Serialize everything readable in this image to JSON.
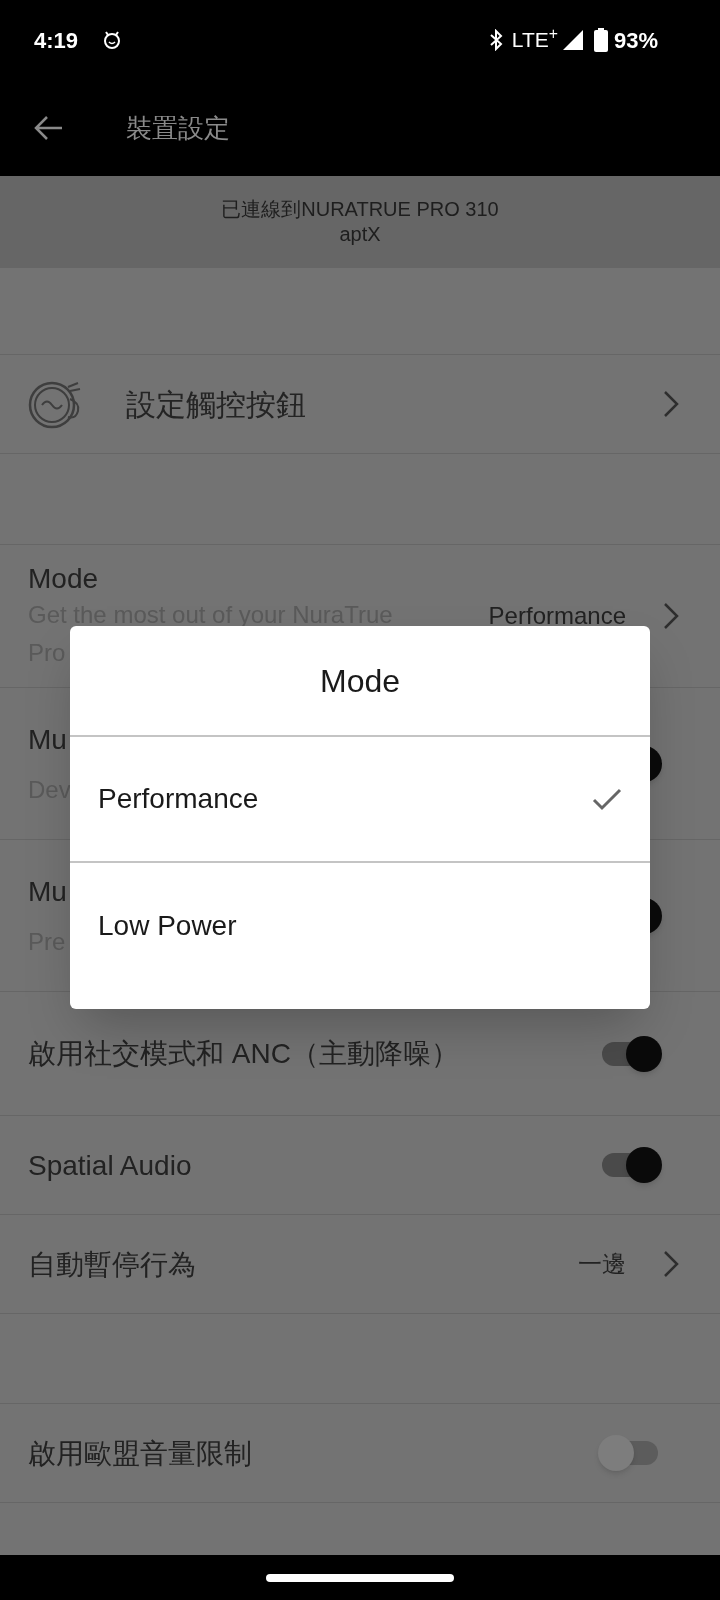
{
  "status_bar": {
    "time": "4:19",
    "network": "LTE$^{+}$",
    "battery": "93%"
  },
  "app_bar": {
    "title": "裝置設定"
  },
  "connection": {
    "device": "已連線到NURATRUE PRO 310",
    "codec": "aptX"
  },
  "sections": [
    {
      "rows": [
        {
          "kind": "link",
          "label": "設定觸控按鈕"
        }
      ]
    },
    {
      "rows": [
        {
          "kind": "value",
          "label": "Mode",
          "subtitle_lines": [
            "Get the most out of your NuraTrue",
            "Pro"
          ],
          "value": "Performance"
        },
        {
          "kind": "toggle",
          "label": "Mu",
          "subtitle": "Dev",
          "on": true
        },
        {
          "kind": "toggle",
          "label": "Mu",
          "subtitle": "Pre",
          "on": true
        },
        {
          "kind": "toggle",
          "label": "啟用社交模式和 ANC（主動降噪）",
          "on": true
        },
        {
          "kind": "toggle",
          "label": "Spatial Audio",
          "on": true
        },
        {
          "kind": "value",
          "label": "自動暫停行為",
          "value": "一邊"
        }
      ]
    },
    {
      "rows": [
        {
          "kind": "toggle",
          "label": "啟用歐盟音量限制",
          "on": false
        }
      ]
    }
  ],
  "dialog": {
    "title": "Mode",
    "options": [
      {
        "label": "Performance",
        "selected": true
      },
      {
        "label": "Low Power",
        "selected": false
      }
    ]
  }
}
